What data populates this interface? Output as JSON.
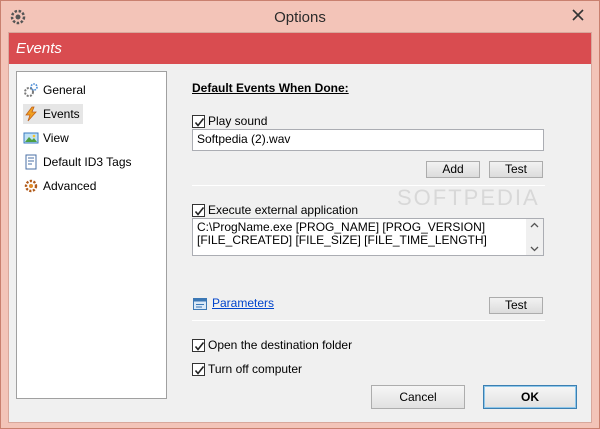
{
  "window": {
    "title": "Options",
    "app_icon": "gear-icon",
    "close_icon": "close-icon"
  },
  "banner": {
    "title": "Events",
    "color": "#d94c50"
  },
  "nav": {
    "items": [
      {
        "label": "General",
        "icon": "gear-icon",
        "selected": false
      },
      {
        "label": "Events",
        "icon": "lightning-icon",
        "selected": true
      },
      {
        "label": "View",
        "icon": "picture-icon",
        "selected": false
      },
      {
        "label": "Default ID3 Tags",
        "icon": "tag-icon",
        "selected": false
      },
      {
        "label": "Advanced",
        "icon": "gear-advanced-icon",
        "selected": false
      }
    ]
  },
  "events": {
    "section_title": "Default Events When Done:",
    "play_sound": {
      "label": "Play sound",
      "checked": true,
      "value": "Softpedia (2).wav",
      "add_label": "Add",
      "test_label": "Test"
    },
    "execute_app": {
      "label": "Execute external application",
      "checked": true,
      "value_line1": "C:\\ProgName.exe [PROG_NAME] [PROG_VERSION]",
      "value_line2": "[FILE_CREATED] [FILE_SIZE] [FILE_TIME_LENGTH]",
      "parameters_label": "Parameters",
      "test_label": "Test"
    },
    "open_folder": {
      "label": "Open the destination folder",
      "checked": true
    },
    "turn_off": {
      "label": "Turn off computer",
      "checked": true
    }
  },
  "buttons": {
    "cancel": "Cancel",
    "ok": "OK"
  },
  "watermark": "SOFTPEDIA"
}
